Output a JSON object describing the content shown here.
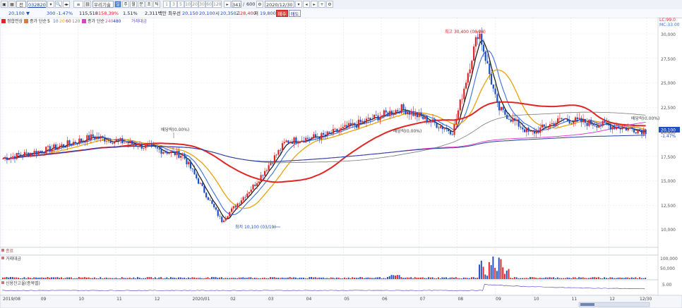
{
  "toolbar": {
    "market": "전",
    "code": "032820",
    "name": "우리기술",
    "period_buttons": [
      "일",
      "주",
      "월",
      "분",
      "초",
      "틱"
    ],
    "interval_buttons": [
      "1",
      "3",
      "5",
      "10",
      "20",
      "30",
      "60",
      "120"
    ],
    "count": "341",
    "total": "600",
    "date": "2020/12/30",
    "buy_label": "매수",
    "sell_label": "매도"
  },
  "quote": {
    "price": "20,100",
    "change": "300",
    "change_pct": "-1.47%",
    "volume": "115,518",
    "volume_ratio": "158.39%",
    "turnover_rate": "1.51%",
    "amount": "2,311백만",
    "basis_label": "최우선",
    "bid": "20,150",
    "ask": "20,100",
    "high_label": "시",
    "open": "20,350",
    "high_label2": "고",
    "high": "28,400",
    "low_label": "저",
    "low": "19,800"
  },
  "legend": {
    "price_chart": "정합전상",
    "ma_label": "종가 단순",
    "ma_periods": [
      "5",
      "10",
      "20",
      "60",
      "120"
    ],
    "ma_colors": [
      "#111111",
      "#3a6fd8",
      "#e8a20c",
      "#e12525",
      "#7a7a7a"
    ],
    "ma2_label": "종가 단순",
    "ma2_periods": [
      "240",
      "480"
    ],
    "ma2_colors": [
      "#e040c8",
      "#2040a0"
    ],
    "extra": "거래대금"
  },
  "indicators": {
    "lc": "LC:99.0",
    "mc": "MC:33.00",
    "price_tag": "20,100",
    "pct_tag": "-1.47%"
  },
  "annotations": {
    "high": "최고 30,400 (08/28)",
    "low": "최저 10,100 (03/19)",
    "div1": "배당락(0.00%)",
    "div2": "배당락(0.00%)",
    "div3": "배당락(0.00%)"
  },
  "panels": {
    "p2": "종료",
    "p3": "거래대금",
    "p4": "신용잔고율(종목별)"
  },
  "y_axis": {
    "price": [
      "30,000",
      "27,500",
      "25,000",
      "22,500",
      "20,000",
      "17,500",
      "15,000",
      "12,500",
      "10,000"
    ],
    "volume": [
      "100,000",
      "50,000"
    ],
    "credit": "5.00"
  },
  "x_axis": {
    "labels": [
      "2019/08",
      "09",
      "10",
      "11",
      "12",
      "2020/01",
      "02",
      "03",
      "04",
      "05",
      "06",
      "07",
      "08",
      "09",
      "10",
      "11",
      "12",
      "12/30"
    ]
  },
  "colors": {
    "up": "#e12525",
    "down": "#1f4fc4",
    "bg": "#ffffff"
  },
  "chart_data": {
    "type": "candlestick",
    "series_close_keypoints": [
      {
        "x": "2019/08",
        "close": 17300
      },
      {
        "x": "2019/10",
        "close": 18200
      },
      {
        "x": "2019/11",
        "close": 19500
      },
      {
        "x": "2020/01",
        "close": 18800
      },
      {
        "x": "2020/02",
        "close": 17600
      },
      {
        "x": "2020/03",
        "close": 10900
      },
      {
        "x": "2020/04",
        "close": 14500
      },
      {
        "x": "2020/05",
        "close": 19000
      },
      {
        "x": "2020/06",
        "close": 19600
      },
      {
        "x": "2020/07",
        "close": 22400
      },
      {
        "x": "2020/08",
        "close": 20000
      },
      {
        "x": "2020/08/28",
        "close": 30400
      },
      {
        "x": "2020/09",
        "close": 22400
      },
      {
        "x": "2020/10",
        "close": 19800
      },
      {
        "x": "2020/11",
        "close": 21300
      },
      {
        "x": "2020/12/30",
        "close": 20100
      }
    ],
    "ylim": [
      9500,
      31000
    ]
  }
}
